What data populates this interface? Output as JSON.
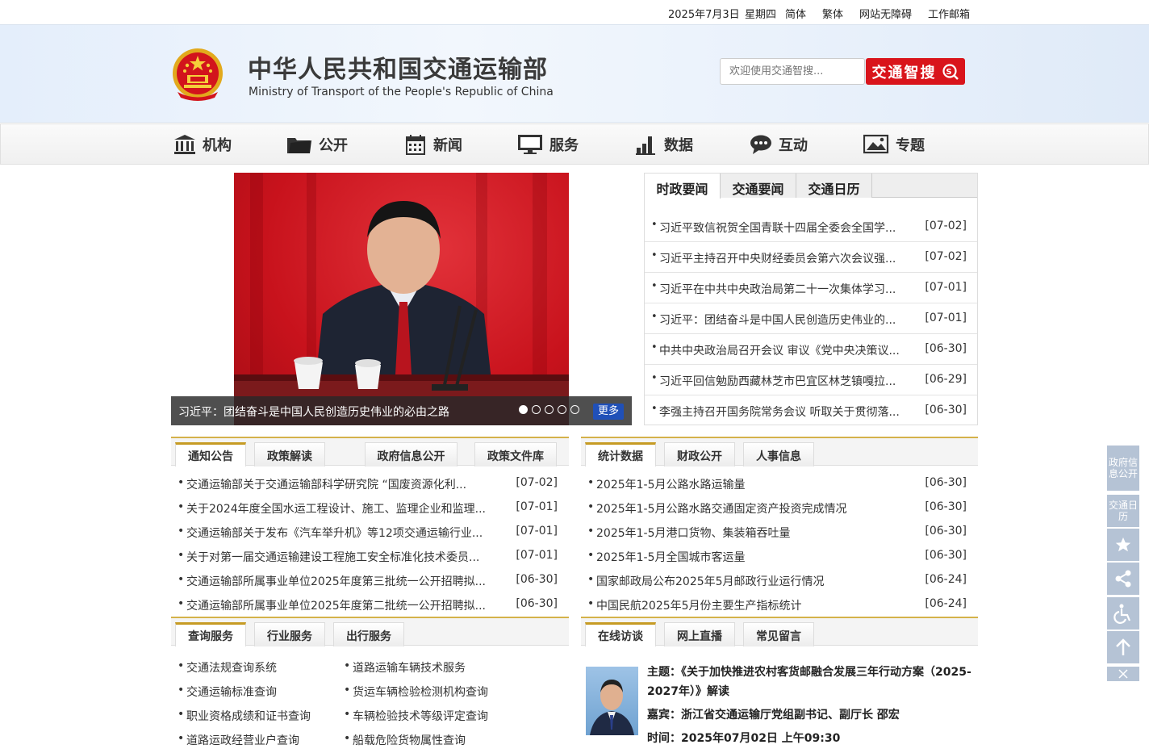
{
  "topbar": {
    "date": "2025年7月3日",
    "weekday": "星期四",
    "simplified": "简体",
    "traditional": "繁体",
    "accessibility": "网站无障碍",
    "mail": "工作邮箱"
  },
  "header": {
    "title": "中华人民共和国交通运输部",
    "subtitle": "Ministry of Transport of the People's Republic of China",
    "search_placeholder": "欢迎使用交通智搜...",
    "search_button": "交通智搜"
  },
  "nav": {
    "items": [
      {
        "label": "机构",
        "icon": "building-icon"
      },
      {
        "label": "公开",
        "icon": "folder-icon"
      },
      {
        "label": "新闻",
        "icon": "calendar-icon"
      },
      {
        "label": "服务",
        "icon": "monitor-icon"
      },
      {
        "label": "数据",
        "icon": "bar-chart-icon"
      },
      {
        "label": "互动",
        "icon": "chat-icon"
      },
      {
        "label": "专题",
        "icon": "image-icon"
      }
    ]
  },
  "carousel": {
    "caption": "习近平：团结奋斗是中国人民创造历史伟业的必由之路",
    "slide_count": 5,
    "active_slide": 1,
    "more": "更多"
  },
  "news": {
    "tabs": [
      "时政要闻",
      "交通要闻",
      "交通日历"
    ],
    "items": [
      {
        "title": "习近平致信祝贺全国青联十四届全委会全国学...",
        "date": "[07-02]"
      },
      {
        "title": "习近平主持召开中央财经委员会第六次会议强...",
        "date": "[07-02]"
      },
      {
        "title": "习近平在中共中央政治局第二十一次集体学习...",
        "date": "[07-01]"
      },
      {
        "title": "习近平：团结奋斗是中国人民创造历史伟业的...",
        "date": "[07-01]"
      },
      {
        "title": "中共中央政治局召开会议 审议《党中央决策议...",
        "date": "[06-30]"
      },
      {
        "title": "习近平回信勉励西藏林芝市巴宜区林芝镇嘎拉...",
        "date": "[06-29]"
      },
      {
        "title": "李强主持召开国务院常务会议 听取关于贯彻落...",
        "date": "[06-30]"
      }
    ]
  },
  "notices": {
    "tabs": [
      "通知公告",
      "政策解读",
      "政府信息公开",
      "政策文件库"
    ],
    "items": [
      {
        "title": "交通运输部关于交通运输部科学研究院 “国废资源化利...",
        "date": "[07-02]"
      },
      {
        "title": "关于2024年度全国水运工程设计、施工、监理企业和监理...",
        "date": "[07-01]"
      },
      {
        "title": "交通运输部关于发布《汽车举升机》等12项交通运输行业...",
        "date": "[07-01]"
      },
      {
        "title": "关于对第一届交通运输建设工程施工安全标准化技术委员...",
        "date": "[07-01]"
      },
      {
        "title": "交通运输部所属事业单位2025年度第三批统一公开招聘拟...",
        "date": "[06-30]"
      },
      {
        "title": "交通运输部所属事业单位2025年度第二批统一公开招聘拟...",
        "date": "[06-30]"
      }
    ]
  },
  "stats": {
    "tabs": [
      "统计数据",
      "财政公开",
      "人事信息"
    ],
    "items": [
      {
        "title": "2025年1-5月公路水路运输量",
        "date": "[06-30]"
      },
      {
        "title": "2025年1-5月公路水路交通固定资产投资完成情况",
        "date": "[06-30]"
      },
      {
        "title": "2025年1-5月港口货物、集装箱吞吐量",
        "date": "[06-30]"
      },
      {
        "title": "2025年1-5月全国城市客运量",
        "date": "[06-30]"
      },
      {
        "title": "国家邮政局公布2025年5月邮政行业运行情况",
        "date": "[06-24]"
      },
      {
        "title": "中国民航2025年5月份主要生产指标统计",
        "date": "[06-24]"
      }
    ]
  },
  "services": {
    "tabs": [
      "查询服务",
      "行业服务",
      "出行服务"
    ],
    "left": [
      "交通法规查询系统",
      "交通运输标准查询",
      "职业资格成绩和证书查询",
      "道路运政经营业户查询"
    ],
    "right": [
      "道路运输车辆技术服务",
      "货运车辆检验检测机构查询",
      "车辆检验技术等级评定查询",
      "船载危险货物属性查询"
    ]
  },
  "interview": {
    "tabs": [
      "在线访谈",
      "网上直播",
      "常见留言"
    ],
    "topic_line1": "主题：《关于加快推进农村客货邮融合发展三年行动方案（2025-",
    "topic_line2": "2027年）》解读",
    "guest": "嘉宾：浙江省交通运输厅党组副书记、副厅长 邵宏",
    "time": "时间：2025年07月02日 上午09:30"
  },
  "side_tools": {
    "gov_info": "政府信息公开",
    "calendar": "交通日历"
  },
  "colors": {
    "brand_red": "#d9141b",
    "gold": "#c69b24",
    "side_blue": "#b5c3d5",
    "more_blue": "#2050b8"
  }
}
